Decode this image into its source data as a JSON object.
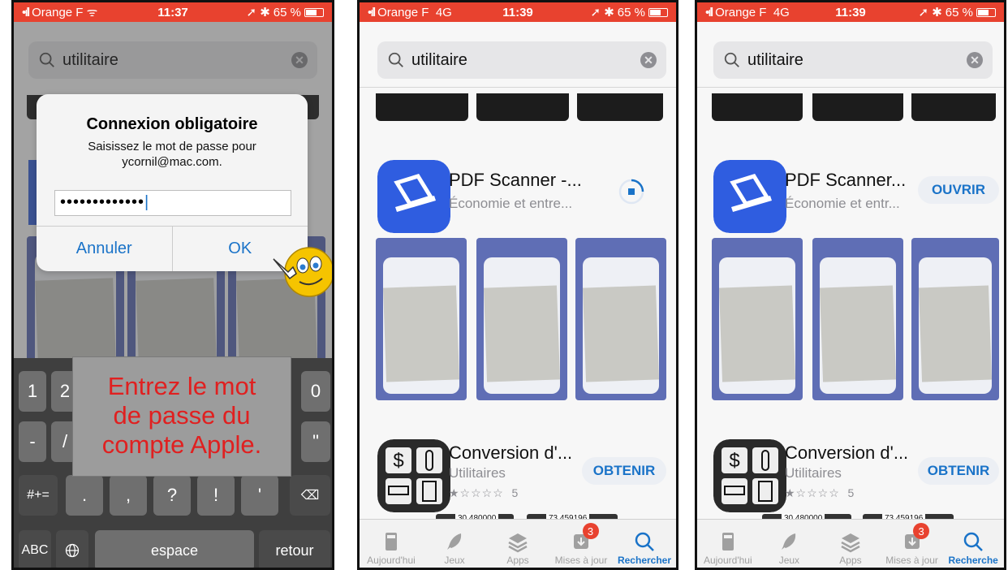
{
  "status": [
    {
      "carrier": "Orange F",
      "net": "",
      "time": "11:37",
      "battery": "65 %"
    },
    {
      "carrier": "Orange F",
      "net": "4G",
      "time": "11:39",
      "battery": "65 %"
    },
    {
      "carrier": "Orange F",
      "net": "4G",
      "time": "11:39",
      "battery": "65 %"
    }
  ],
  "search": {
    "query": "utilitaire"
  },
  "dialog": {
    "title": "Connexion obligatoire",
    "message_line1": "Saisissez le mot de passe pour",
    "message_line2": "ycornil@mac.com.",
    "password_mask": "•••••••••••••",
    "cancel": "Annuler",
    "ok": "OK"
  },
  "overlay_text": {
    "line1": "Entrez le mot",
    "line2": "de passe du",
    "line3": "compte Apple."
  },
  "keyboard": {
    "row1": [
      "1",
      "2",
      "0"
    ],
    "row2": [
      "-",
      "/",
      "\""
    ],
    "row3": [
      "#+=",
      ".",
      ",",
      "?",
      "!",
      "'"
    ],
    "row4": {
      "abc": "ABC",
      "space": "espace",
      "return": "retour"
    }
  },
  "apps": [
    {
      "title_p2": "PDF Scanner -...",
      "title_p3": "PDF Scanner...",
      "subtitle_p2": "Économie et entre...",
      "subtitle_p3": "Économie et entr...",
      "action_p3": "OUVRIR"
    },
    {
      "title": "Conversion d'...",
      "subtitle": "Utilitaires",
      "action": "OBTENIR",
      "rating": "★☆☆☆☆",
      "rating_count": "5",
      "peek1": "30,480000",
      "peek2": "73,459196"
    }
  ],
  "tabs": [
    {
      "label": "Aujourd'hui",
      "icon": "today-icon"
    },
    {
      "label": "Jeux",
      "icon": "rocket-icon"
    },
    {
      "label": "Apps",
      "icon": "layers-icon"
    },
    {
      "label": "Mises à jour",
      "icon": "download-icon",
      "badge": "3"
    },
    {
      "label": "Recherche",
      "icon": "search-icon"
    }
  ],
  "tab_label_active_p2": "Rechercher",
  "colors": {
    "status": "#e8422f",
    "accent": "#1a73c8",
    "overlay_text": "#e02020"
  }
}
